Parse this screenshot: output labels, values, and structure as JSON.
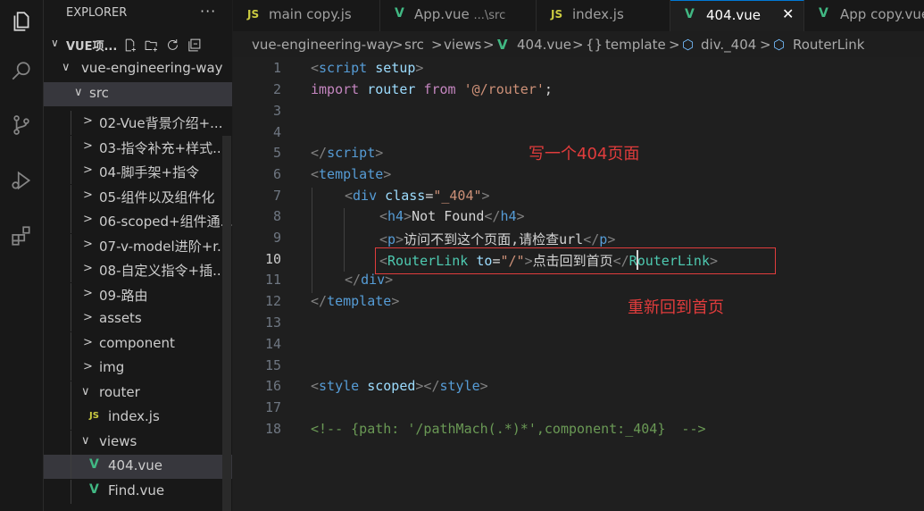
{
  "activity_bar": {
    "items": [
      {
        "name": "explorer-icon"
      },
      {
        "name": "search-icon"
      },
      {
        "name": "source-control-icon"
      },
      {
        "name": "run-debug-icon"
      },
      {
        "name": "extensions-icon"
      }
    ]
  },
  "sidebar": {
    "title": "EXPLORER",
    "more": "···",
    "section_title": "VUE项...",
    "tree": [
      {
        "label": "vue-engineering-way",
        "chev": "∨"
      },
      {
        "label": "src",
        "chev": "∨"
      },
      {
        "label": "02-Vue背景介绍+...",
        "chev": ">"
      },
      {
        "label": "03-指令补充+样式...",
        "chev": ">"
      },
      {
        "label": "04-脚手架+指令",
        "chev": ">"
      },
      {
        "label": "05-组件以及组件化",
        "chev": ">"
      },
      {
        "label": "06-scoped+组件通...",
        "chev": ">"
      },
      {
        "label": "07-v-model进阶+r...",
        "chev": ">"
      },
      {
        "label": "08-自定义指令+插...",
        "chev": ">"
      },
      {
        "label": "09-路由",
        "chev": ">"
      },
      {
        "label": "assets",
        "chev": ">"
      },
      {
        "label": "component",
        "chev": ">"
      },
      {
        "label": "img",
        "chev": ">"
      },
      {
        "label": "router",
        "chev": "∨"
      },
      {
        "label": "index.js",
        "icon": "JS"
      },
      {
        "label": "views",
        "chev": "∨"
      },
      {
        "label": "404.vue",
        "icon": "V"
      },
      {
        "label": "Find.vue",
        "icon": "V"
      }
    ]
  },
  "tabs": [
    {
      "icon": "JS",
      "label": "main copy.js"
    },
    {
      "icon": "V",
      "label": "App.vue",
      "desc": "...\\src"
    },
    {
      "icon": "JS",
      "label": "index.js"
    },
    {
      "icon": "V",
      "label": "404.vue",
      "close": "✕"
    },
    {
      "icon": "V",
      "label": "App copy.vue"
    }
  ],
  "breadcrumbs": {
    "items": [
      "vue-engineering-way",
      "src",
      "views",
      "404.vue",
      "template",
      "div._404",
      "RouterLink"
    ],
    "sep": ">",
    "template_icon": "{}",
    "vue_icon": "V"
  },
  "editor": {
    "line_numbers": [
      "1",
      "2",
      "3",
      "4",
      "5",
      "6",
      "7",
      "8",
      "9",
      "10",
      "11",
      "12",
      "13",
      "14",
      "15",
      "16",
      "17",
      "18"
    ],
    "current_line": "10",
    "lines": {
      "l1": [
        "<",
        "script",
        " ",
        "setup",
        ">"
      ],
      "l2": [
        "import",
        " ",
        "router",
        " ",
        "from",
        " ",
        "'@/router'",
        ";"
      ],
      "l5": [
        "</",
        "script",
        ">"
      ],
      "l6": [
        "<",
        "template",
        ">"
      ],
      "l7": [
        "<",
        "div",
        " ",
        "class",
        "=",
        "\"_404\"",
        ">"
      ],
      "l8": [
        "<",
        "h4",
        ">",
        "Not Found",
        "</",
        "h4",
        ">"
      ],
      "l9": [
        "<",
        "p",
        ">",
        "访问不到这个页面,请检查url",
        "</",
        "p",
        ">"
      ],
      "l10": [
        "<",
        "RouterLink",
        " ",
        "to",
        "=",
        "\"/\"",
        ">",
        "点击回到首页",
        "</",
        "RouterLink",
        ">"
      ],
      "l11": [
        "</",
        "div",
        ">"
      ],
      "l12": [
        "</",
        "template",
        ">"
      ],
      "l16": [
        "<",
        "style",
        " ",
        "scoped",
        "></",
        "style",
        ">"
      ],
      "l18": "<!-- {path: '/pathMach(.*)*',component:_404}  -->"
    },
    "annotations": {
      "note1": "写一个404页面",
      "note2": "重新回到首页"
    }
  },
  "colors": {
    "keyword_tag": "#569cd6",
    "attribute": "#9cdcfe",
    "string": "#ce9178",
    "import_keyword": "#c586c0",
    "comment": "#6a9955",
    "component": "#4ec9b0",
    "annotation_red": "#e03c3c",
    "vue_green": "#41b883",
    "js_yellow": "#cbcb41",
    "active_tab_border": "#0078d4"
  }
}
